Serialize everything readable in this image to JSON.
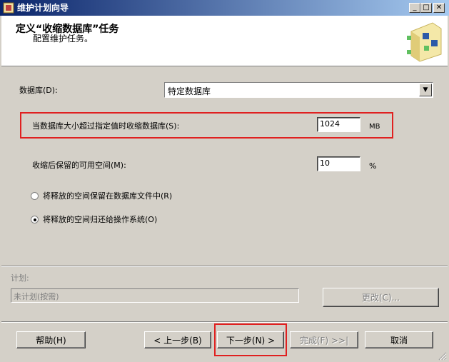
{
  "window": {
    "title": "维护计划向导",
    "minimize_glyph": "_",
    "maximize_glyph": "□",
    "close_glyph": "✕"
  },
  "header": {
    "title": "定义“收缩数据库”任务",
    "subtitle": "配置维护任务。"
  },
  "form": {
    "database_label": "数据库(D):",
    "database_value": "特定数据库",
    "shrink_threshold_label": "当数据库大小超过指定值时收缩数据库(S):",
    "shrink_threshold_value": "1024",
    "shrink_threshold_unit": "MB",
    "free_space_label": "收缩后保留的可用空间(M):",
    "free_space_value": "10",
    "free_space_unit": "%",
    "radio_retain_label": "将释放的空间保留在数据库文件中(R)",
    "radio_return_label": "将释放的空间归还给操作系统(O)",
    "selected_radio": "return"
  },
  "schedule": {
    "label": "计划:",
    "value": "未计划(按需)",
    "change_button": "更改(C)..."
  },
  "buttons": {
    "help": "帮助(H)",
    "back": "< 上一步(B)",
    "next": "下一步(N) >",
    "finish": "完成(F) >>|",
    "cancel": "取消"
  }
}
